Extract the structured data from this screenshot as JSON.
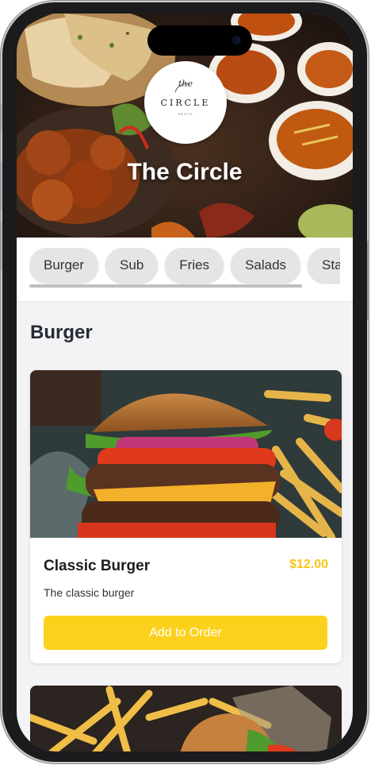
{
  "restaurant": {
    "name": "The Circle",
    "logo": {
      "script_text": "the",
      "word": "CIRCLE",
      "tagline": "RESTO"
    }
  },
  "categories": [
    "Burger",
    "Sub",
    "Fries",
    "Salads",
    "Sta"
  ],
  "section": {
    "title": "Burger"
  },
  "menu_items": [
    {
      "name": "Classic Burger",
      "price": "$12.00",
      "description": "The classic burger",
      "button_label": "Add to Order"
    }
  ],
  "colors": {
    "accent": "#fcd11c",
    "price": "#f5c518",
    "chip_bg": "#e5e5e8",
    "title": "#262b35"
  }
}
